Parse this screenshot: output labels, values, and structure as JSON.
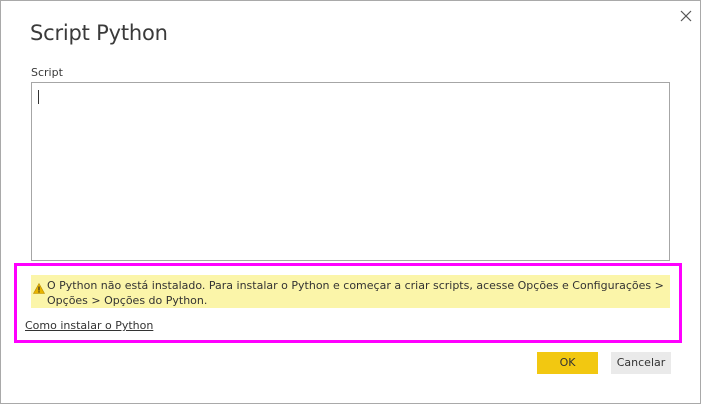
{
  "dialog": {
    "title": "Script Python",
    "close_icon": "close-icon"
  },
  "script": {
    "label": "Script",
    "value": ""
  },
  "warning": {
    "icon": "warning-icon",
    "text": "O Python não está instalado. Para instalar o Python e começar a criar scripts, acesse Opções e Configurações > Opções > Opções do Python."
  },
  "links": {
    "install": "Como instalar o Python"
  },
  "buttons": {
    "ok": "OK",
    "cancel": "Cancelar"
  },
  "colors": {
    "ok_button": "#f2c811",
    "warning_background": "#fbf5a9",
    "highlight_border": "#ff00ff"
  }
}
